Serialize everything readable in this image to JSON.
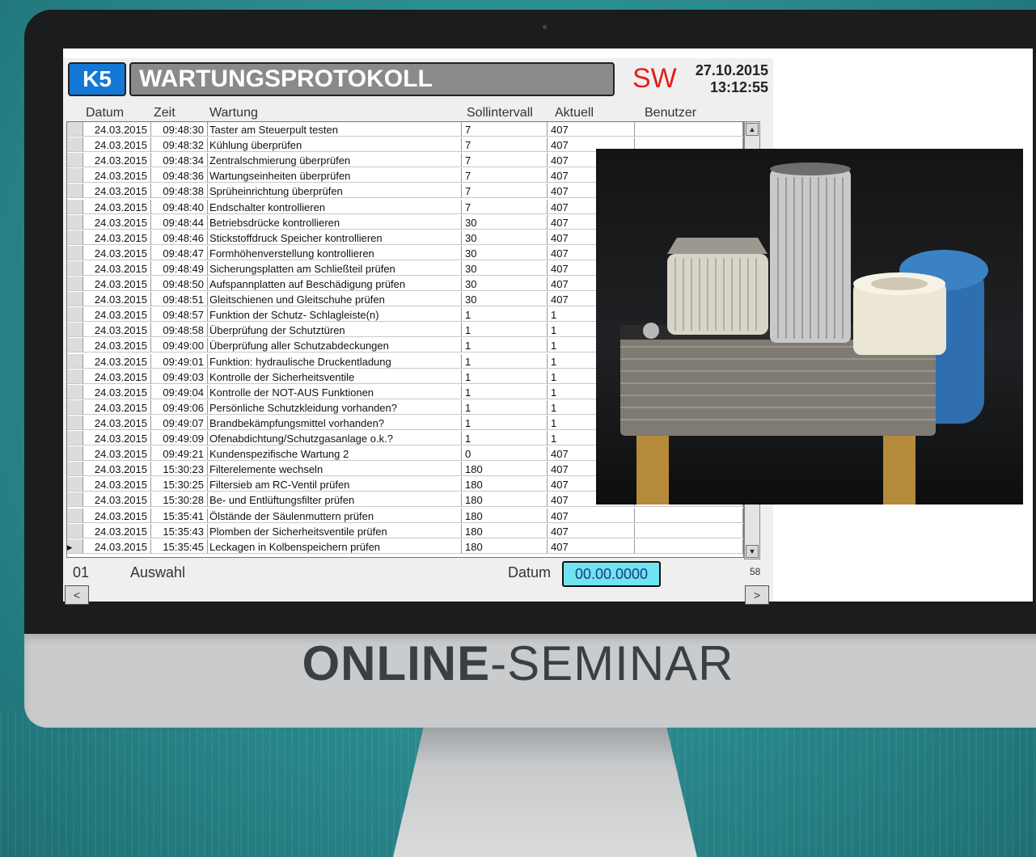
{
  "app": {
    "machine_badge": "K5",
    "title": "WARTUNGSPROTOKOLL",
    "user_code": "SW",
    "date": "27.10.2015",
    "time": "13:12:55"
  },
  "columns": [
    "Datum",
    "Zeit",
    "Wartung",
    "Sollintervall",
    "Aktuell",
    "Benutzer"
  ],
  "rows": [
    {
      "datum": "24.03.2015",
      "zeit": "09:48:30",
      "wartung": "Taster am Steuerpult testen",
      "soll": "7",
      "aktuell": "407"
    },
    {
      "datum": "24.03.2015",
      "zeit": "09:48:32",
      "wartung": "Kühlung überprüfen",
      "soll": "7",
      "aktuell": "407"
    },
    {
      "datum": "24.03.2015",
      "zeit": "09:48:34",
      "wartung": "Zentralschmierung überprüfen",
      "soll": "7",
      "aktuell": "407"
    },
    {
      "datum": "24.03.2015",
      "zeit": "09:48:36",
      "wartung": "Wartungseinheiten überprüfen",
      "soll": "7",
      "aktuell": "407"
    },
    {
      "datum": "24.03.2015",
      "zeit": "09:48:38",
      "wartung": "Sprüheinrichtung überprüfen",
      "soll": "7",
      "aktuell": "407"
    },
    {
      "datum": "24.03.2015",
      "zeit": "09:48:40",
      "wartung": "Endschalter kontrollieren",
      "soll": "7",
      "aktuell": "407"
    },
    {
      "datum": "24.03.2015",
      "zeit": "09:48:44",
      "wartung": "Betriebsdrücke kontrollieren",
      "soll": "30",
      "aktuell": "407"
    },
    {
      "datum": "24.03.2015",
      "zeit": "09:48:46",
      "wartung": "Stickstoffdruck Speicher kontrollieren",
      "soll": "30",
      "aktuell": "407"
    },
    {
      "datum": "24.03.2015",
      "zeit": "09:48:47",
      "wartung": "Formhöhenverstellung kontrollieren",
      "soll": "30",
      "aktuell": "407"
    },
    {
      "datum": "24.03.2015",
      "zeit": "09:48:49",
      "wartung": "Sicherungsplatten am Schließteil prüfen",
      "soll": "30",
      "aktuell": "407"
    },
    {
      "datum": "24.03.2015",
      "zeit": "09:48:50",
      "wartung": "Aufspannplatten auf Beschädigung prüfen",
      "soll": "30",
      "aktuell": "407"
    },
    {
      "datum": "24.03.2015",
      "zeit": "09:48:51",
      "wartung": "Gleitschienen und Gleitschuhe prüfen",
      "soll": "30",
      "aktuell": "407"
    },
    {
      "datum": "24.03.2015",
      "zeit": "09:48:57",
      "wartung": "Funktion der Schutz- Schlagleiste(n)",
      "soll": "1",
      "aktuell": "1"
    },
    {
      "datum": "24.03.2015",
      "zeit": "09:48:58",
      "wartung": "Überprüfung der Schutztüren",
      "soll": "1",
      "aktuell": "1"
    },
    {
      "datum": "24.03.2015",
      "zeit": "09:49:00",
      "wartung": "Überprüfung aller Schutzabdeckungen",
      "soll": "1",
      "aktuell": "1"
    },
    {
      "datum": "24.03.2015",
      "zeit": "09:49:01",
      "wartung": "Funktion: hydraulische Druckentladung",
      "soll": "1",
      "aktuell": "1"
    },
    {
      "datum": "24.03.2015",
      "zeit": "09:49:03",
      "wartung": "Kontrolle der Sicherheitsventile",
      "soll": "1",
      "aktuell": "1"
    },
    {
      "datum": "24.03.2015",
      "zeit": "09:49:04",
      "wartung": "Kontrolle der NOT-AUS Funktionen",
      "soll": "1",
      "aktuell": "1"
    },
    {
      "datum": "24.03.2015",
      "zeit": "09:49:06",
      "wartung": "Persönliche Schutzkleidung vorhanden?",
      "soll": "1",
      "aktuell": "1"
    },
    {
      "datum": "24.03.2015",
      "zeit": "09:49:07",
      "wartung": "Brandbekämpfungsmittel vorhanden?",
      "soll": "1",
      "aktuell": "1"
    },
    {
      "datum": "24.03.2015",
      "zeit": "09:49:09",
      "wartung": "Ofenabdichtung/Schutzgasanlage o.k.?",
      "soll": "1",
      "aktuell": "1"
    },
    {
      "datum": "24.03.2015",
      "zeit": "09:49:21",
      "wartung": "Kundenspezifische Wartung 2",
      "soll": "0",
      "aktuell": "407"
    },
    {
      "datum": "24.03.2015",
      "zeit": "15:30:23",
      "wartung": "Filterelemente wechseln",
      "soll": "180",
      "aktuell": "407"
    },
    {
      "datum": "24.03.2015",
      "zeit": "15:30:25",
      "wartung": "Filtersieb am RC-Ventil prüfen",
      "soll": "180",
      "aktuell": "407"
    },
    {
      "datum": "24.03.2015",
      "zeit": "15:30:28",
      "wartung": "Be- und Entlüftungsfilter prüfen",
      "soll": "180",
      "aktuell": "407"
    },
    {
      "datum": "24.03.2015",
      "zeit": "15:35:41",
      "wartung": "Ölstände der Säulenmuttern prüfen",
      "soll": "180",
      "aktuell": "407"
    },
    {
      "datum": "24.03.2015",
      "zeit": "15:35:43",
      "wartung": "Plomben der Sicherheitsventile prüfen",
      "soll": "180",
      "aktuell": "407"
    },
    {
      "datum": "24.03.2015",
      "zeit": "15:35:45",
      "wartung": "Leckagen in Kolbenspeichern prüfen",
      "soll": "180",
      "aktuell": "407"
    }
  ],
  "current_row_marker": "▸",
  "footer": {
    "page": "01",
    "auswahl_label": "Auswahl",
    "datum_label": "Datum",
    "datum_value": "00.00.0000",
    "count": "58",
    "prev": "<",
    "next": ">"
  },
  "scroll": {
    "up": "▲",
    "down": "▼"
  },
  "promo": {
    "bold": "ONLINE",
    "rest": "-SEMINAR"
  },
  "colors": {
    "badge": "#1478d4",
    "title_bg": "#8a8a8a",
    "sw": "#e02020",
    "datum_box": "#6fe3ef",
    "background": "#2a8a8e"
  }
}
